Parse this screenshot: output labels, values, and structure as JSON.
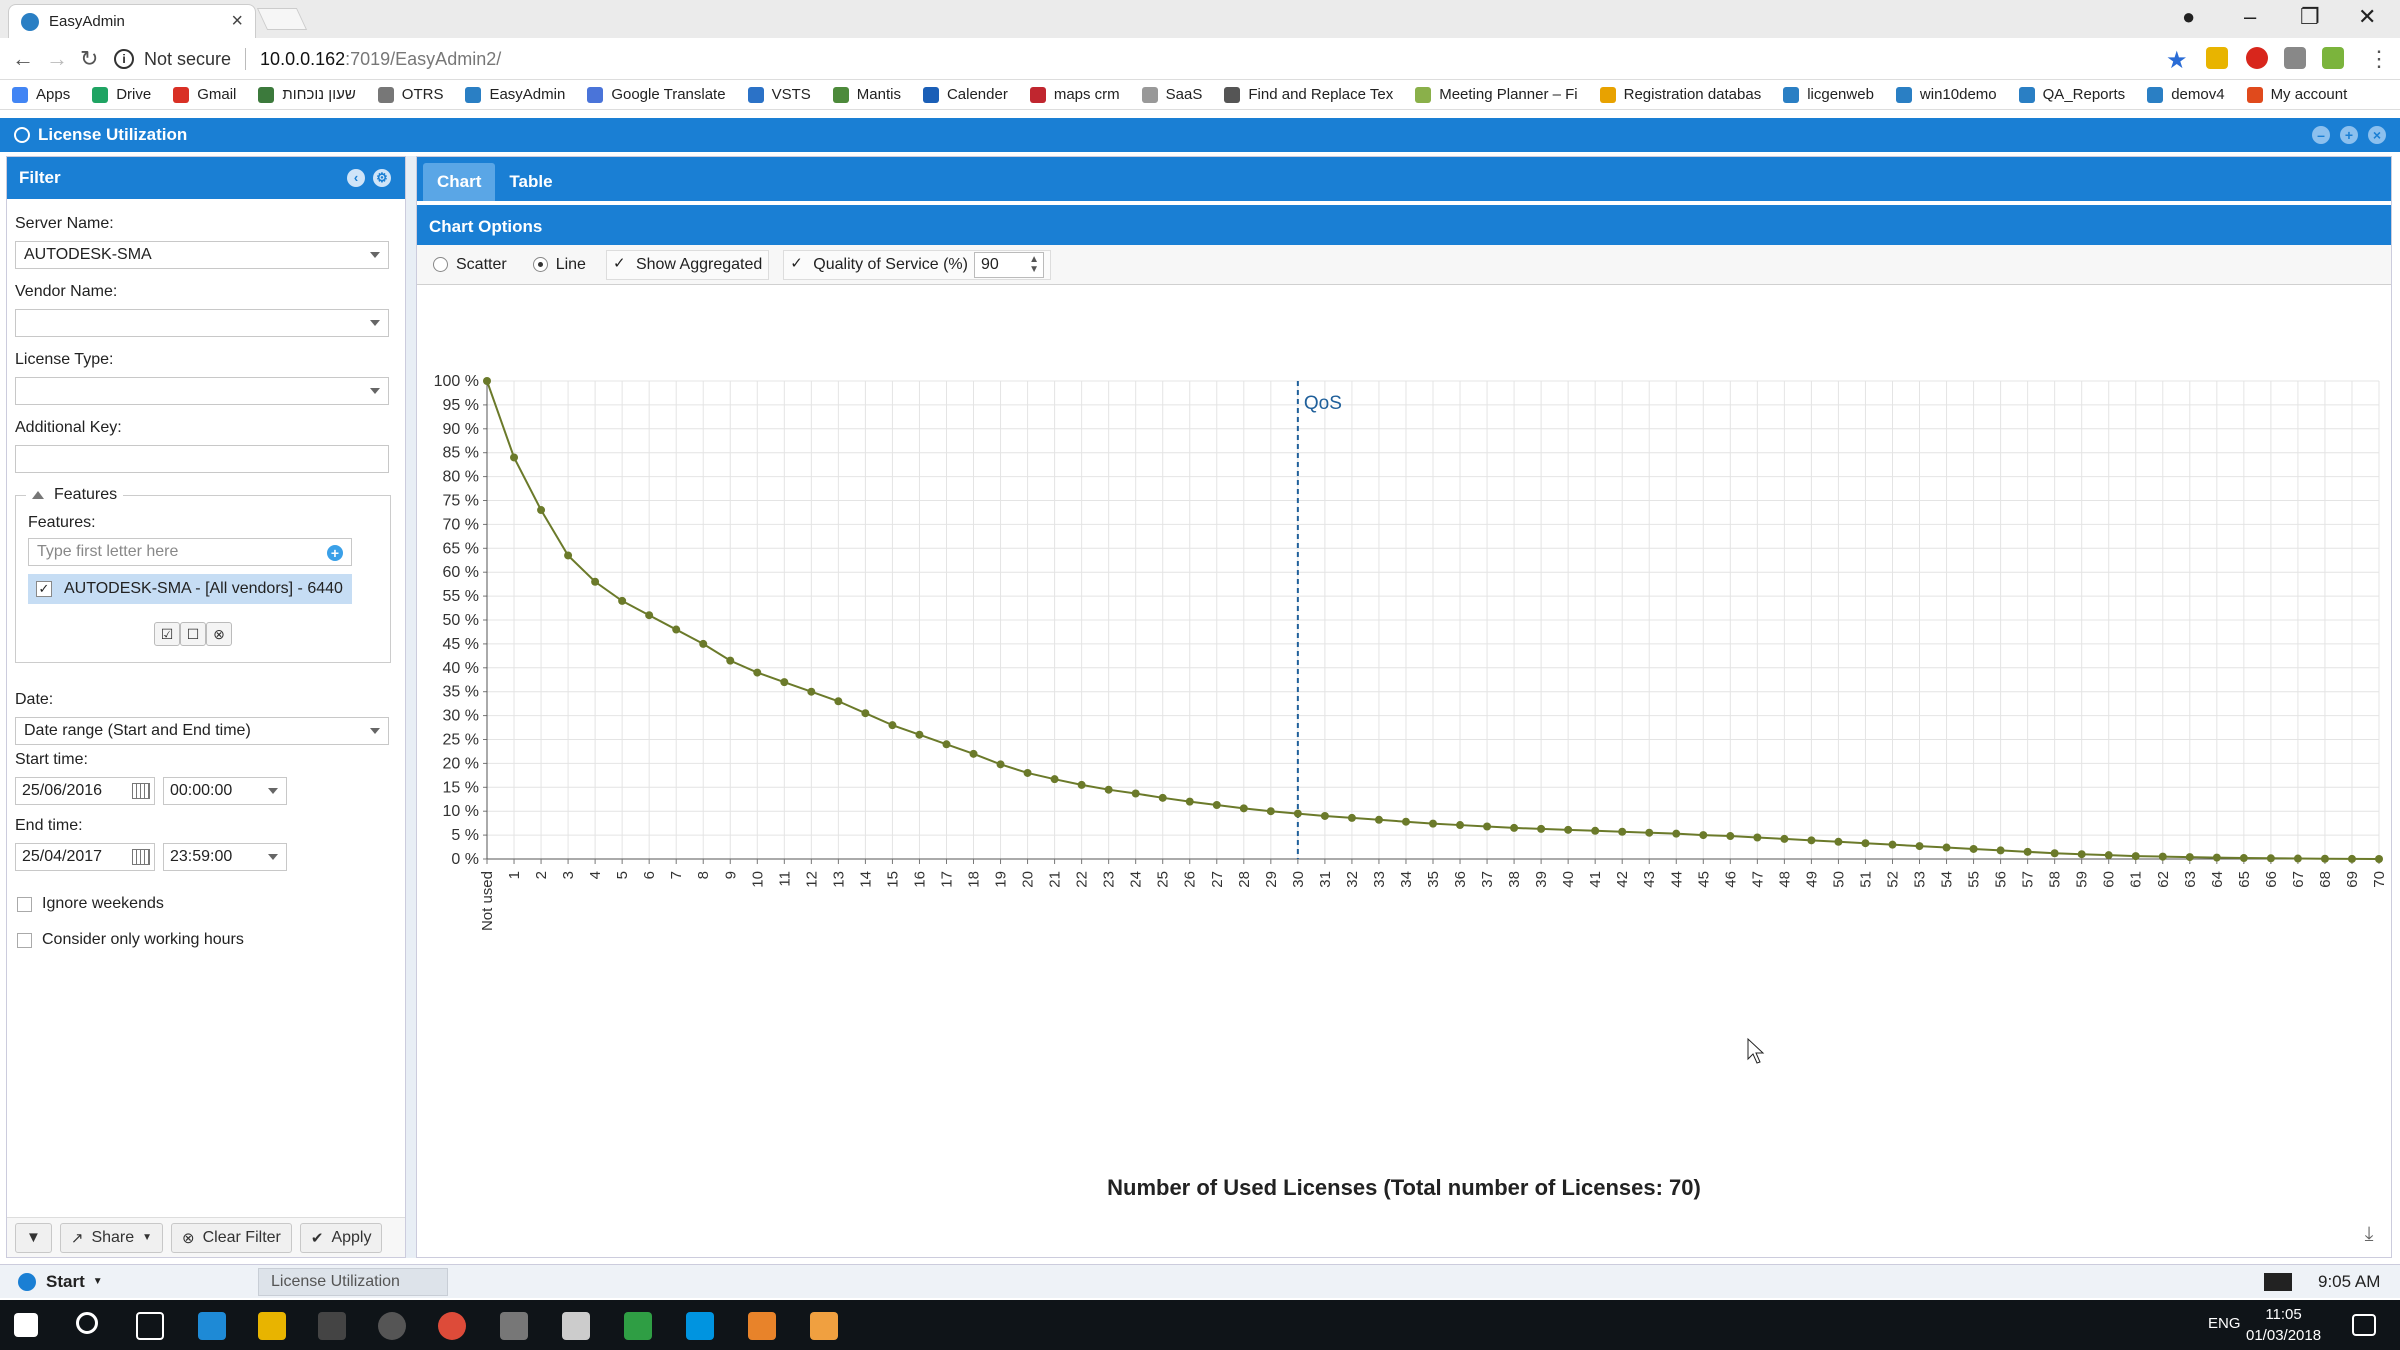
{
  "browser": {
    "tab_title": "EasyAdmin",
    "not_secure_label": "Not secure",
    "url_host": "10.0.0.162",
    "url_rest": ":7019/EasyAdmin2/",
    "bookmarks": [
      {
        "label": "Apps",
        "color": "#4285f4"
      },
      {
        "label": "Drive",
        "color": "#1fa463"
      },
      {
        "label": "Gmail",
        "color": "#d93025"
      },
      {
        "label": "שעון נוכחות",
        "color": "#3c7a3c"
      },
      {
        "label": "OTRS",
        "color": "#777777"
      },
      {
        "label": "EasyAdmin",
        "color": "#2a7fc4"
      },
      {
        "label": "Google Translate",
        "color": "#4a74d9"
      },
      {
        "label": "VSTS",
        "color": "#2b72c7"
      },
      {
        "label": "Mantis",
        "color": "#4d8a3b"
      },
      {
        "label": "Calender",
        "color": "#1b5fb7"
      },
      {
        "label": "maps crm",
        "color": "#c0262f"
      },
      {
        "label": "SaaS",
        "color": "#999999"
      },
      {
        "label": "Find and Replace Tex",
        "color": "#555555"
      },
      {
        "label": "Meeting Planner – Fi",
        "color": "#8ab04a"
      },
      {
        "label": "Registration databas",
        "color": "#e8a200"
      },
      {
        "label": "licgenweb",
        "color": "#2a7fc4"
      },
      {
        "label": "win10demo",
        "color": "#2a7fc4"
      },
      {
        "label": "QA_Reports",
        "color": "#2a7fc4"
      },
      {
        "label": "demov4",
        "color": "#2a7fc4"
      },
      {
        "label": "My account",
        "color": "#e04a1c"
      }
    ]
  },
  "app": {
    "title": "License Utilization"
  },
  "filter": {
    "title": "Filter",
    "server_label": "Server Name:",
    "server_value": "AUTODESK-SMA",
    "vendor_label": "Vendor Name:",
    "vendor_value": "",
    "license_type_label": "License Type:",
    "license_type_value": "",
    "additional_key_label": "Additional Key:",
    "additional_key_value": "",
    "features_legend": "Features",
    "features_label": "Features:",
    "features_placeholder": "Type first letter here",
    "feature_item": "AUTODESK-SMA - [All vendors] - 6440",
    "date_label": "Date:",
    "date_value": "Date range (Start and End time)",
    "start_label": "Start time:",
    "start_date": "25/06/2016",
    "start_time": "00:00:00",
    "end_label": "End time:",
    "end_date": "25/04/2017",
    "end_time": "23:59:00",
    "ignore_weekends": "Ignore weekends",
    "working_hours": "Consider only working hours",
    "share": "Share",
    "clear_filter": "Clear Filter",
    "apply": "Apply"
  },
  "main": {
    "tabs": [
      "Chart",
      "Table"
    ],
    "options_title": "Chart Options",
    "opt_scatter": "Scatter",
    "opt_line": "Line",
    "opt_aggregated": "Show Aggregated",
    "opt_qos": "Quality of Service (%)",
    "qos_value": "90"
  },
  "chart_data": {
    "type": "line",
    "xlabel": "Number of Used Licenses (Total number of Licenses: 70)",
    "ylabel": "",
    "x_categories": [
      "Not used",
      "1",
      "2",
      "3",
      "4",
      "5",
      "6",
      "7",
      "8",
      "9",
      "10",
      "11",
      "12",
      "13",
      "14",
      "15",
      "16",
      "17",
      "18",
      "19",
      "20",
      "21",
      "22",
      "23",
      "24",
      "25",
      "26",
      "27",
      "28",
      "29",
      "30",
      "31",
      "32",
      "33",
      "34",
      "35",
      "36",
      "37",
      "38",
      "39",
      "40",
      "41",
      "42",
      "43",
      "44",
      "45",
      "46",
      "47",
      "48",
      "49",
      "50",
      "51",
      "52",
      "53",
      "54",
      "55",
      "56",
      "57",
      "58",
      "59",
      "60",
      "61",
      "62",
      "63",
      "64",
      "65",
      "66",
      "67",
      "68",
      "69",
      "70"
    ],
    "y_ticks": [
      "0 %",
      "5 %",
      "10 %",
      "15 %",
      "20 %",
      "25 %",
      "30 %",
      "35 %",
      "40 %",
      "45 %",
      "50 %",
      "55 %",
      "60 %",
      "65 %",
      "70 %",
      "75 %",
      "80 %",
      "85 %",
      "90 %",
      "95 %",
      "100 %"
    ],
    "ylim": [
      0,
      100
    ],
    "values": [
      100,
      84,
      73,
      63.5,
      58,
      54,
      51,
      48,
      45,
      41.5,
      39,
      37,
      35,
      33,
      30.5,
      28,
      26,
      24,
      22,
      19.8,
      18,
      16.7,
      15.5,
      14.5,
      13.7,
      12.8,
      12,
      11.3,
      10.6,
      10,
      9.5,
      9,
      8.6,
      8.2,
      7.8,
      7.4,
      7.1,
      6.8,
      6.5,
      6.3,
      6.1,
      5.9,
      5.7,
      5.5,
      5.3,
      5.0,
      4.8,
      4.5,
      4.2,
      3.9,
      3.6,
      3.3,
      3.0,
      2.7,
      2.4,
      2.1,
      1.8,
      1.5,
      1.2,
      1.0,
      0.8,
      0.6,
      0.5,
      0.4,
      0.3,
      0.2,
      0.15,
      0.1,
      0.05,
      0.02,
      0
    ],
    "qos_marker": {
      "label": "QoS",
      "x_index": 30
    },
    "grid": true,
    "line_color": "#6b7a2a",
    "qos_color": "#1f5f9a"
  },
  "status": {
    "start": "Start",
    "task": "License Utilization",
    "time": "9:05 AM"
  },
  "taskbar": {
    "lang": "ENG",
    "clock_time": "11:05",
    "clock_date": "01/03/2018"
  }
}
